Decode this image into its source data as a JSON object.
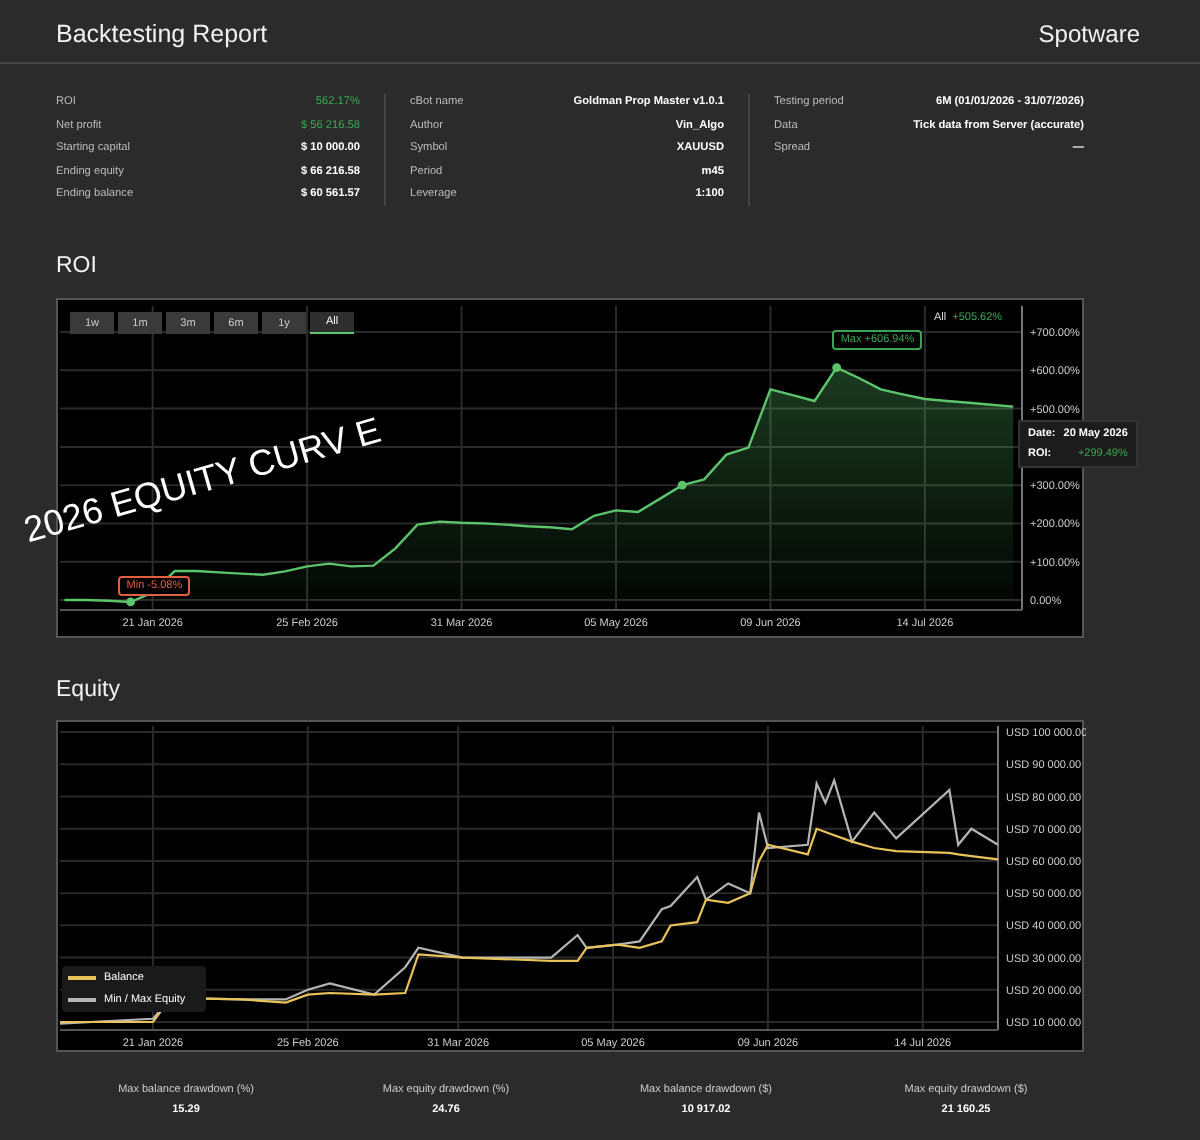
{
  "header": {
    "title": "Backtesting Report",
    "brand": "Spotware"
  },
  "stats": [
    [
      {
        "label": "ROI",
        "value": "562.17%",
        "highlight": true
      },
      {
        "label": "Net profit",
        "value": "$ 56 216.58",
        "highlight": true
      },
      {
        "label": "Starting capital",
        "value": "$ 10 000.00",
        "highlight": false
      },
      {
        "label": "Ending equity",
        "value": "$ 66 216.58",
        "highlight": false
      },
      {
        "label": "Ending balance",
        "value": "$ 60 561.57",
        "highlight": false
      }
    ],
    [
      {
        "label": "cBot name",
        "value": "Goldman Prop Master v1.0.1",
        "highlight": false
      },
      {
        "label": "Author",
        "value": "Vin_Algo",
        "highlight": false
      },
      {
        "label": "Symbol",
        "value": "XAUUSD",
        "highlight": false
      },
      {
        "label": "Period",
        "value": "m45",
        "highlight": false
      },
      {
        "label": "Leverage",
        "value": "1:100",
        "highlight": false
      }
    ],
    [
      {
        "label": "Testing period",
        "value": "6M (01/01/2026 - 31/07/2026)",
        "highlight": false
      },
      {
        "label": "Data",
        "value": "Tick data from Server (accurate)",
        "highlight": false
      },
      {
        "label": "Spread",
        "value": "—",
        "highlight": false
      }
    ]
  ],
  "roi_section": {
    "heading": "ROI",
    "ranges": [
      {
        "label": "1w",
        "selected": false
      },
      {
        "label": "1m",
        "selected": false
      },
      {
        "label": "3m",
        "selected": false
      },
      {
        "label": "6m",
        "selected": false
      },
      {
        "label": "1y",
        "selected": false
      },
      {
        "label": "All",
        "selected": true
      }
    ],
    "summary": {
      "label": "All",
      "value": "+505.62%"
    },
    "tooltip": {
      "date_label": "Date:",
      "date": "20 May 2026",
      "roi_label": "ROI:",
      "roi": "+299.49%"
    },
    "overlay_text": "2026 EQUITY CURV E",
    "chart_data": {
      "type": "area",
      "grid": true,
      "ylim": [
        -26,
        768
      ],
      "categories": [
        null,
        null,
        null,
        null,
        "21 Jan 2026",
        null,
        null,
        null,
        null,
        null,
        null,
        "25 Feb 2026",
        null,
        null,
        null,
        null,
        null,
        null,
        "31 Mar 2026",
        null,
        null,
        null,
        null,
        null,
        null,
        "05 May 2026",
        null,
        null,
        null,
        null,
        null,
        null,
        "09 Jun 2026",
        null,
        null,
        null,
        null,
        null,
        null,
        "14 Jul 2026",
        null,
        null,
        null,
        null
      ],
      "yticks": [
        {
          "value": 700,
          "label": "+700.00%"
        },
        {
          "value": 600,
          "label": "+600.00%"
        },
        {
          "value": 500,
          "label": "+500.00%"
        },
        {
          "value": 300,
          "label": "+300.00%"
        },
        {
          "value": 200,
          "label": "+200.00%"
        },
        {
          "value": 100,
          "label": "+100.00%"
        },
        {
          "value": 0,
          "label": "0.00%"
        }
      ],
      "series": [
        {
          "color": "#5cc46a",
          "values": [
            0,
            0,
            -2,
            -5,
            20,
            76,
            76,
            72,
            69,
            66,
            75,
            88,
            95,
            88,
            90,
            135,
            197,
            205,
            202,
            200,
            197,
            193,
            190,
            185,
            220,
            234,
            230,
            265,
            300,
            315,
            380,
            398,
            550,
            535,
            520,
            607,
            580,
            550,
            537,
            525,
            520,
            515,
            510,
            505
          ]
        }
      ],
      "annotations": [
        "Max +606.94%",
        "Min -5.08%"
      ]
    }
  },
  "equity_section": {
    "heading": "Equity",
    "y_labels": [
      "USD 100 000.00",
      "USD 90 000.00",
      "USD 80 000.00",
      "USD 70 000.00",
      "USD 60 000.00",
      "USD 50 000.00",
      "USD 40 000.00",
      "USD 30 000.00",
      "USD 20 000.00",
      "USD 10 000.00"
    ],
    "x_labels": [
      "21 Jan 2026",
      "25 Feb 2026",
      "31 Mar 2026",
      "05 May 2026",
      "09 Jun 2026",
      "14 Jul 2026"
    ],
    "legend": [
      {
        "label": "Balance",
        "color": "#e8c35a"
      },
      {
        "label": "Min / Max Equity",
        "color": "#b5b5b5"
      }
    ]
  },
  "drawdowns": [
    {
      "label": "Max balance drawdown (%)",
      "value": "15.29"
    },
    {
      "label": "Max equity drawdown (%)",
      "value": "24.76"
    },
    {
      "label": "Max balance drawdown ($)",
      "value": "10 917.02"
    },
    {
      "label": "Max equity drawdown ($)",
      "value": "21 160.25"
    }
  ]
}
